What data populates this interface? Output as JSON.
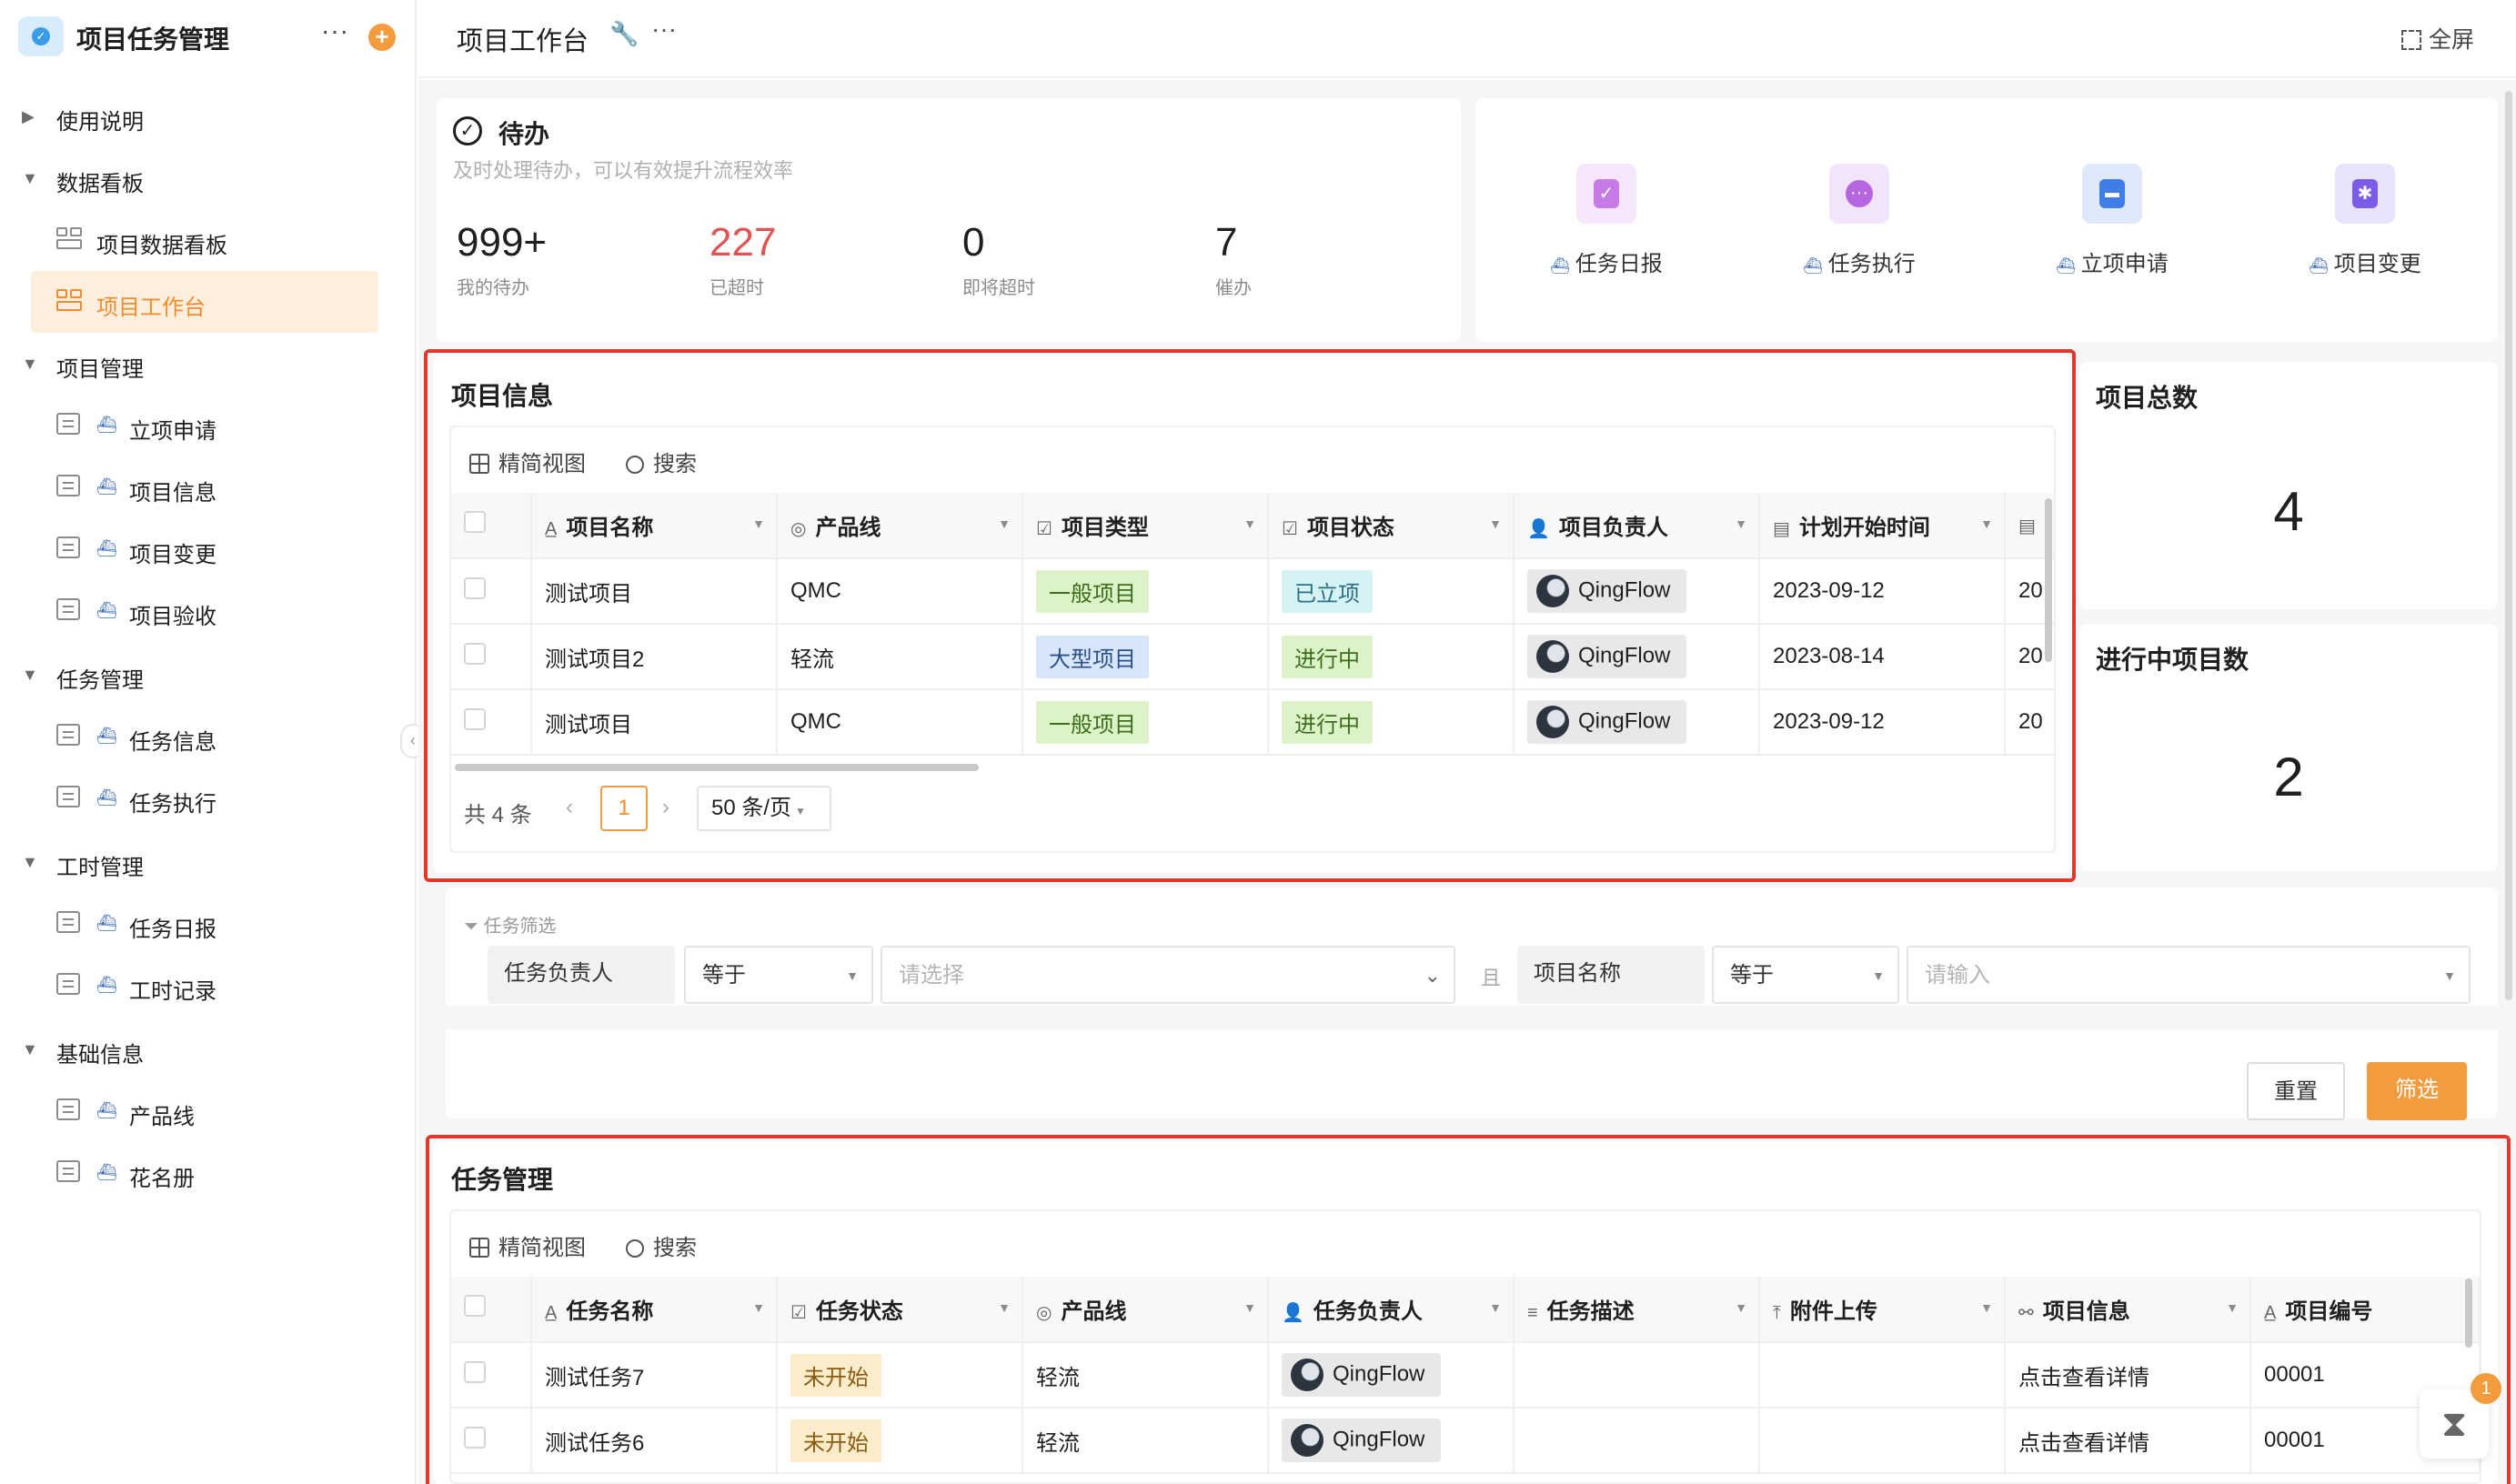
{
  "app": {
    "title": "项目任务管理"
  },
  "sidebar": {
    "items": [
      {
        "label": "使用说明"
      },
      {
        "label": "数据看板"
      },
      {
        "label": "项目数据看板"
      },
      {
        "label": "项目工作台"
      },
      {
        "label": "项目管理"
      },
      {
        "label": "立项申请"
      },
      {
        "label": "项目信息"
      },
      {
        "label": "项目变更"
      },
      {
        "label": "项目验收"
      },
      {
        "label": "任务管理"
      },
      {
        "label": "任务信息"
      },
      {
        "label": "任务执行"
      },
      {
        "label": "工时管理"
      },
      {
        "label": "任务日报"
      },
      {
        "label": "工时记录"
      },
      {
        "label": "基础信息"
      },
      {
        "label": "产品线"
      },
      {
        "label": "花名册"
      }
    ]
  },
  "header": {
    "title": "项目工作台",
    "fullscreen": "全屏"
  },
  "todo": {
    "title": "待办",
    "subtitle": "及时处理待办，可以有效提升流程效率",
    "stats": [
      {
        "value": "999+",
        "caption": "我的待办"
      },
      {
        "value": "227",
        "caption": "已超时"
      },
      {
        "value": "0",
        "caption": "即将超时"
      },
      {
        "value": "7",
        "caption": "催办"
      }
    ]
  },
  "quick_links": [
    {
      "label": "任务日报",
      "icon": "clipboard-check-icon",
      "bg": "#f5e6fb",
      "fg": "#c77be6"
    },
    {
      "label": "任务执行",
      "icon": "chat-bubble-icon",
      "bg": "#f1e4fb",
      "fg": "#b566e0"
    },
    {
      "label": "立项申请",
      "icon": "bookmark-icon",
      "bg": "#dde9fb",
      "fg": "#3f7ee6"
    },
    {
      "label": "项目变更",
      "icon": "gear-icon",
      "bg": "#e7e3fb",
      "fg": "#7a5ce6"
    }
  ],
  "project_info": {
    "title": "项目信息",
    "view_label": "精简视图",
    "search_label": "搜索",
    "columns": [
      "项目名称",
      "产品线",
      "项目类型",
      "项目状态",
      "项目负责人",
      "计划开始时间"
    ],
    "rows": [
      {
        "name": "测试项目",
        "line": "QMC",
        "type": "一般项目",
        "type_color": "green",
        "status": "已立项",
        "status_color": "cyan",
        "owner": "QingFlow",
        "start": "2023-09-12",
        "cut": "20"
      },
      {
        "name": "测试项目2",
        "line": "轻流",
        "type": "大型项目",
        "type_color": "blue",
        "status": "进行中",
        "status_color": "green",
        "owner": "QingFlow",
        "start": "2023-08-14",
        "cut": "20"
      },
      {
        "name": "测试项目",
        "line": "QMC",
        "type": "一般项目",
        "type_color": "green",
        "status": "进行中",
        "status_color": "green",
        "owner": "QingFlow",
        "start": "2023-09-12",
        "cut": "20"
      }
    ],
    "total_text": "共 4 条",
    "current_page": "1",
    "page_size": "50 条/页"
  },
  "kpi": [
    {
      "title": "项目总数",
      "value": "4"
    },
    {
      "title": "进行中项目数",
      "value": "2"
    }
  ],
  "filter": {
    "label": "任务筛选",
    "field1": "任务负责人",
    "op1": "等于",
    "value1_placeholder": "请选择",
    "and": "且",
    "field2": "项目名称",
    "op2": "等于",
    "value2_placeholder": "请输入",
    "reset": "重置",
    "apply": "筛选"
  },
  "task_mgmt": {
    "title": "任务管理",
    "view_label": "精简视图",
    "search_label": "搜索",
    "columns": [
      "任务名称",
      "任务状态",
      "产品线",
      "任务负责人",
      "任务描述",
      "附件上传",
      "项目信息",
      "项目编号"
    ],
    "rows": [
      {
        "name": "测试任务7",
        "status": "未开始",
        "line": "轻流",
        "owner": "QingFlow",
        "desc": "",
        "attach": "",
        "proj": "点击查看详情",
        "code": "00001"
      },
      {
        "name": "测试任务6",
        "status": "未开始",
        "line": "轻流",
        "owner": "QingFlow",
        "desc": "",
        "attach": "",
        "proj": "点击查看详情",
        "code": "00001"
      }
    ]
  },
  "notification_badge": "1"
}
